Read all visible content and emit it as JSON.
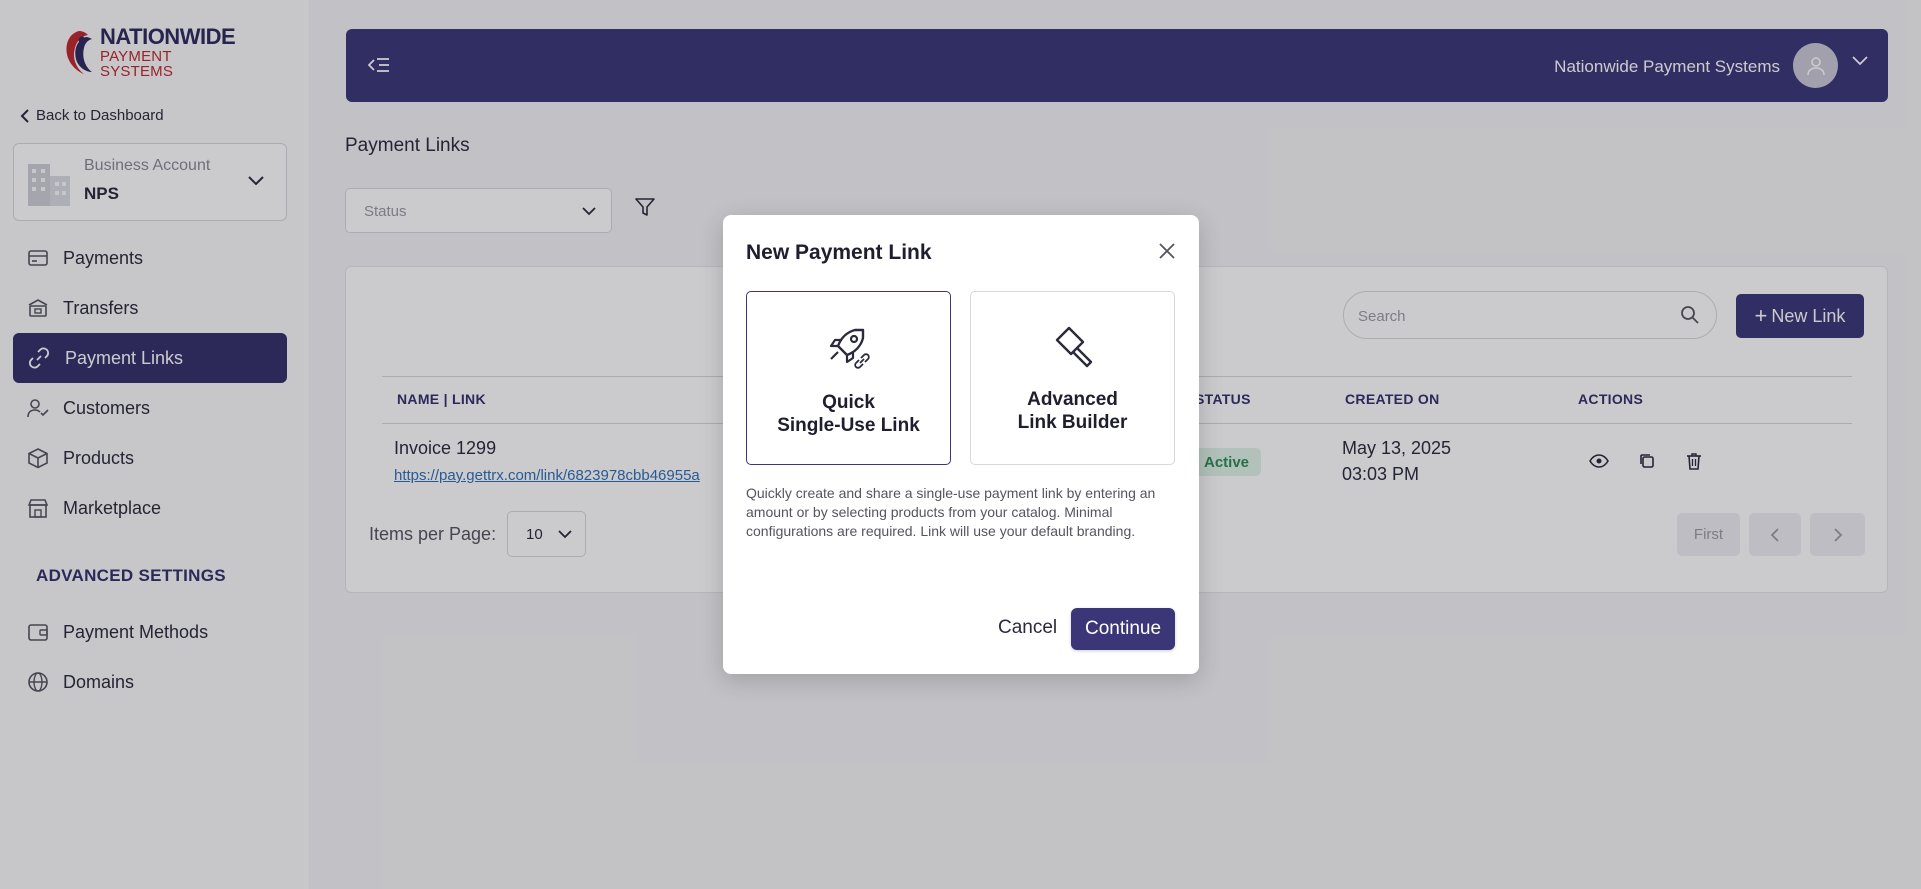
{
  "brand": {
    "line1": "NATIONWIDE",
    "line2": "PAYMENT SYSTEMS",
    "primary": "#3a3677",
    "accent": "#c1272d"
  },
  "sidebar": {
    "back_label": "Back to Dashboard",
    "account": {
      "label": "Business Account",
      "name": "NPS"
    },
    "items": [
      {
        "label": "Payments",
        "icon": "card-icon",
        "active": false
      },
      {
        "label": "Transfers",
        "icon": "bank-icon",
        "active": false
      },
      {
        "label": "Payment Links",
        "icon": "link-icon",
        "active": true
      },
      {
        "label": "Customers",
        "icon": "user-check-icon",
        "active": false
      },
      {
        "label": "Products",
        "icon": "box-icon",
        "active": false
      },
      {
        "label": "Marketplace",
        "icon": "store-icon",
        "active": false
      }
    ],
    "section_title": "ADVANCED SETTINGS",
    "advanced_items": [
      {
        "label": "Payment Methods",
        "icon": "wallet-icon"
      },
      {
        "label": "Domains",
        "icon": "globe-icon"
      }
    ]
  },
  "topbar": {
    "org_name": "Nationwide Payment Systems"
  },
  "page": {
    "title": "Payment Links",
    "status_placeholder": "Status",
    "search_placeholder": "Search",
    "new_link_label": "New Link",
    "columns": [
      "NAME | LINK",
      "STATUS",
      "CREATED ON",
      "ACTIONS"
    ],
    "rows": [
      {
        "name": "Invoice 1299",
        "link": "https://pay.gettrx.com/link/6823978cbb46955a",
        "status": "Active",
        "created_date": "May 13, 2025",
        "created_time": "03:03 PM"
      }
    ],
    "items_per_page_label": "Items per Page:",
    "items_per_page": "10",
    "pagination": {
      "first": "First"
    }
  },
  "modal": {
    "title": "New Payment Link",
    "options": [
      {
        "label": "Quick\nSingle-Use Link",
        "icon": "rocket-link-icon",
        "selected": true
      },
      {
        "label": "Advanced\nLink Builder",
        "icon": "hammer-icon",
        "selected": false
      }
    ],
    "description": "Quickly create and share a single-use payment link by entering an amount or by selecting products from your catalog. Minimal configurations are required. Link will use your default branding.",
    "cancel_label": "Cancel",
    "continue_label": "Continue"
  }
}
